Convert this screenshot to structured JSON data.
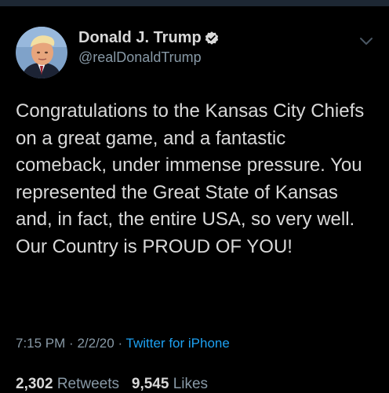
{
  "tweet": {
    "author": {
      "name": "Donald J. Trump",
      "handle": "@realDonaldTrump",
      "verified": true,
      "avatar_icon": "profile-photo"
    },
    "menu_icon": "chevron-down-icon",
    "text": "Congratulations to the Kansas City Chiefs on a great game, and a fantastic comeback, under immense pressure. You represented the Great State of Kansas and, in fact, the entire USA, so very well. Our Country is PROUD OF YOU!",
    "time": "7:15 PM",
    "separator": "·",
    "date": "2/2/20",
    "source": "Twitter for iPhone",
    "retweets_count": "2,302",
    "retweets_label": "Retweets",
    "likes_count": "9,545",
    "likes_label": "Likes"
  },
  "colors": {
    "background": "#000000",
    "primary_text": "#d9d9d9",
    "secondary_text": "#8899a6",
    "link": "#1da1f2",
    "verified_badge": "#d9d9d9"
  }
}
